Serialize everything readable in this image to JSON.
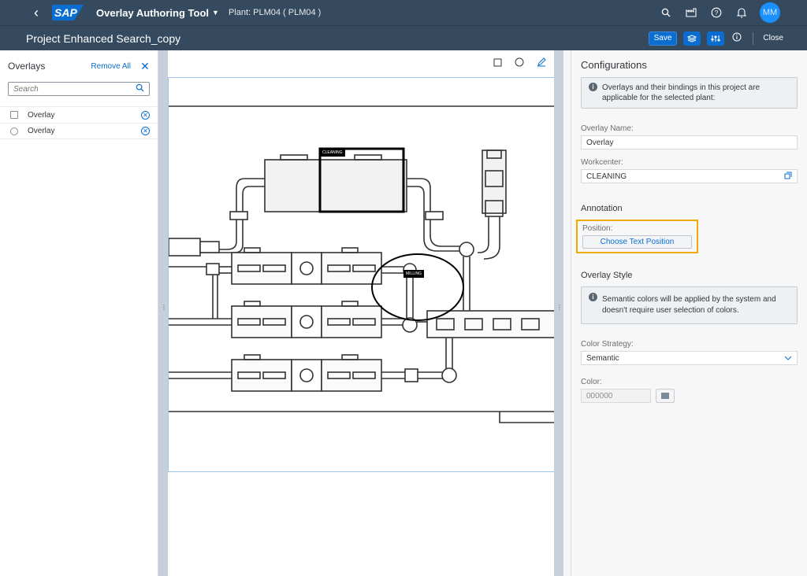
{
  "shell": {
    "app_title": "Overlay Authoring Tool",
    "plant_label": "Plant: PLM04 ( PLM04 )",
    "logo_text": "SAP",
    "avatar_initials": "MM"
  },
  "subheader": {
    "title": "Project Enhanced Search_copy",
    "save_label": "Save",
    "close_label": "Close"
  },
  "overlays": {
    "title": "Overlays",
    "remove_all": "Remove All",
    "search_placeholder": "Search",
    "items": [
      {
        "label": "Overlay",
        "control": "checkbox"
      },
      {
        "label": "Overlay",
        "control": "radio"
      }
    ]
  },
  "canvas": {
    "tags": {
      "cleaning": "CLEANING",
      "milling": "MILLING"
    }
  },
  "config": {
    "title": "Configurations",
    "info_message": "Overlays and their bindings in this project are applicable for the selected plant:",
    "overlay_name_label": "Overlay Name:",
    "overlay_name_value": "Overlay",
    "workcenter_label": "Workcenter:",
    "workcenter_value": "CLEANING",
    "annotation_title": "Annotation",
    "position_label": "Position:",
    "choose_position": "Choose Text Position",
    "style_title": "Overlay Style",
    "style_message": "Semantic colors will be applied by the system and doesn't require user selection of colors.",
    "color_strategy_label": "Color Strategy:",
    "color_strategy_value": "Semantic",
    "color_label": "Color:",
    "color_value": "000000"
  }
}
